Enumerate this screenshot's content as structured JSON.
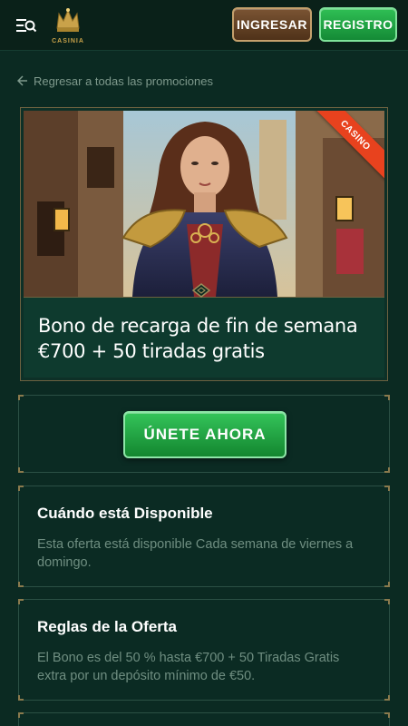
{
  "header": {
    "logo_text": "CASINIA",
    "login_label": "INGRESAR",
    "register_label": "REGISTRO"
  },
  "back_link": {
    "label": "Regresar a todas las promociones"
  },
  "promo": {
    "badge": "CASINO",
    "title_line1": "Bono de recarga de fin de semana",
    "title_line2": "€700 + 50 tiradas gratis"
  },
  "cta": {
    "label": "ÚNETE AHORA"
  },
  "sections": [
    {
      "title": "Cuándo está Disponible",
      "text": "Esta oferta está disponible Cada semana de viernes a domingo."
    },
    {
      "title": "Reglas de la Oferta",
      "text": "El Bono es del 50 % hasta €700 + 50 Tiradas Gratis extra por un depósito mínimo de €50."
    }
  ],
  "colors": {
    "background": "#0b2a22",
    "green_button": "#1fa043",
    "brown_button": "#6a4628",
    "ribbon": "#e8421e",
    "gold": "#c9a24a"
  }
}
